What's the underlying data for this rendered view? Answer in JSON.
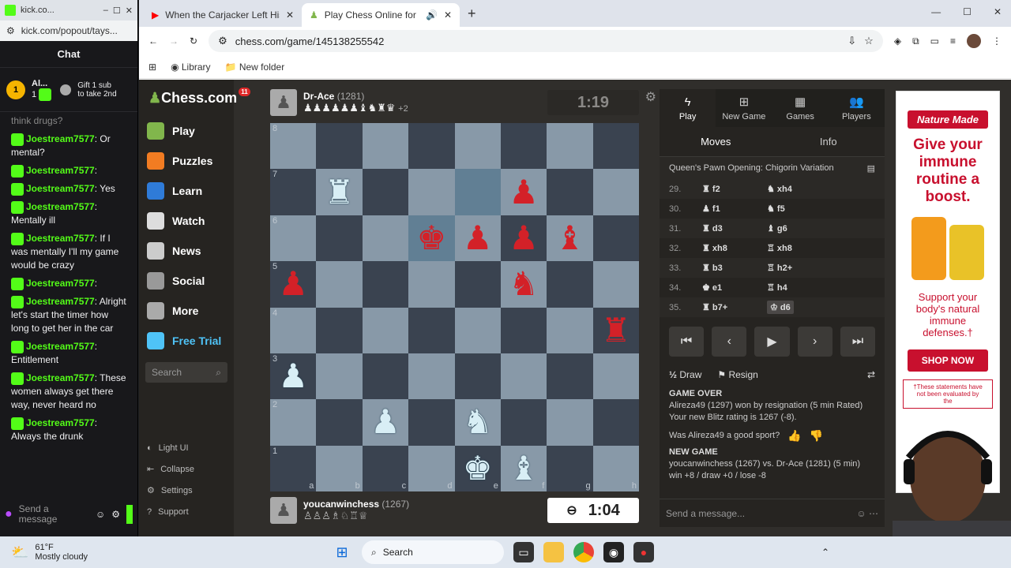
{
  "kick": {
    "tab_title": "kick.co...",
    "url": "kick.com/popout/tays...",
    "chat_title": "Chat",
    "pinned_user": "Al...",
    "pinned_count": "1",
    "gift_text": "Gift 1 sub to take 2nd",
    "faded_text": "think drugs?",
    "messages": [
      {
        "user": "Joestream7577",
        "text": ": Or mental?"
      },
      {
        "user": "Joestream7577",
        "text": ":"
      },
      {
        "user": "Joestream7577",
        "text": ": Yes"
      },
      {
        "user": "Joestream7577",
        "text": ": Mentally ill"
      },
      {
        "user": "Joestream7577",
        "text": ": If I was mentally I'll my game would be crazy"
      },
      {
        "user": "Joestream7577",
        "text": ":"
      },
      {
        "user": "Joestream7577",
        "text": ": Alright let's start the timer how long to get her in the car"
      },
      {
        "user": "Joestream7577",
        "text": ": Entitlement"
      },
      {
        "user": "Joestream7577",
        "text": ": These women always get there way, never heard no"
      },
      {
        "user": "Joestream7577",
        "text": ": Always the drunk"
      }
    ],
    "send_placeholder": "Send a message"
  },
  "browser": {
    "tabs": [
      {
        "title": "When the Carjacker Left His ID I"
      },
      {
        "title": "Play Chess Online for FREE"
      }
    ],
    "url": "chess.com/game/145138255542",
    "bookmarks": [
      "Library",
      "New folder"
    ]
  },
  "chess": {
    "logo": "Chess.com",
    "logo_badge": "11",
    "nav": [
      "Play",
      "Puzzles",
      "Learn",
      "Watch",
      "News",
      "Social",
      "More",
      "Free Trial"
    ],
    "search_placeholder": "Search",
    "bottom_nav": [
      "Light UI",
      "Collapse",
      "Settings",
      "Support"
    ],
    "top_player": {
      "name": "Dr-Ace",
      "rating": "(1281)",
      "captured": "♟♟♟♟♟♟♝♞♜♛",
      "extra": "+2",
      "clock": "1:19"
    },
    "bottom_player": {
      "name": "youcanwinchess",
      "rating": "(1267)",
      "captured": "♙♙♙♗♘♖♕",
      "clock": "1:04"
    },
    "board": [
      [
        "",
        "",
        "",
        "",
        "",
        "",
        "",
        ""
      ],
      [
        "",
        "wR",
        "",
        "",
        "",
        "bP",
        "",
        ""
      ],
      [
        "",
        "",
        "",
        "bK",
        "bP",
        "bP",
        "bB",
        ""
      ],
      [
        "bP",
        "",
        "",
        "",
        "",
        "bN",
        "",
        ""
      ],
      [
        "",
        "",
        "",
        "",
        "",
        "",
        "",
        "bR"
      ],
      [
        "wP",
        "",
        "",
        "",
        "",
        "",
        "",
        ""
      ],
      [
        "",
        "",
        "wP",
        "",
        "wN",
        "",
        "",
        ""
      ],
      [
        "",
        "",
        "",
        "",
        "wK",
        "wB",
        "",
        ""
      ]
    ],
    "ranks": [
      "8",
      "7",
      "6",
      "5",
      "4",
      "3",
      "2",
      "1"
    ],
    "files": [
      "a",
      "b",
      "c",
      "d",
      "e",
      "f",
      "g",
      "h"
    ],
    "right_tabs": [
      "Play",
      "New Game",
      "Games",
      "Players"
    ],
    "sub_tabs": [
      "Moves",
      "Info"
    ],
    "opening": "Queen's Pawn Opening: Chigorin Variation",
    "moves": [
      {
        "n": "29.",
        "w": "♜ f2",
        "b": "♞ xh4"
      },
      {
        "n": "30.",
        "w": "♟ f1",
        "b": "♞ f5"
      },
      {
        "n": "31.",
        "w": "♜ d3",
        "b": "♝ g6"
      },
      {
        "n": "32.",
        "w": "♜ xh8",
        "b": "♖ xh8"
      },
      {
        "n": "33.",
        "w": "♜ b3",
        "b": "♖ h2+"
      },
      {
        "n": "34.",
        "w": "♚ e1",
        "b": "♖ h4"
      },
      {
        "n": "35.",
        "w": "♜ b7+",
        "b": "♔ d6"
      }
    ],
    "draw_label": "Draw",
    "resign_label": "Resign",
    "game_over": "GAME OVER",
    "result_text": "Alireza49 (1297) won by resignation (5 min Rated)",
    "rating_text": "Your new Blitz rating is 1267 (-8).",
    "sport_question": "Was Alireza49 a good sport?",
    "new_game": "NEW GAME",
    "new_game_text": "youcanwinchess (1267) vs. Dr-Ace (1281) (5 min)",
    "odds_text": "win +8 / draw +0 / lose -8",
    "message_placeholder": "Send a message..."
  },
  "ad": {
    "brand": "Nature Made",
    "headline": "Give your immune routine a boost.",
    "body": "Support your body's natural immune defenses.†",
    "cta": "SHOP NOW",
    "footnote": "†These statements have not been evaluated by the"
  },
  "taskbar": {
    "temp": "61°F",
    "weather": "Mostly cloudy",
    "search": "Search"
  },
  "colors": {
    "kick_green": "#53fc18",
    "chess_red": "#d32128",
    "board_light": "#8899a8",
    "board_dark": "#3a4350"
  }
}
